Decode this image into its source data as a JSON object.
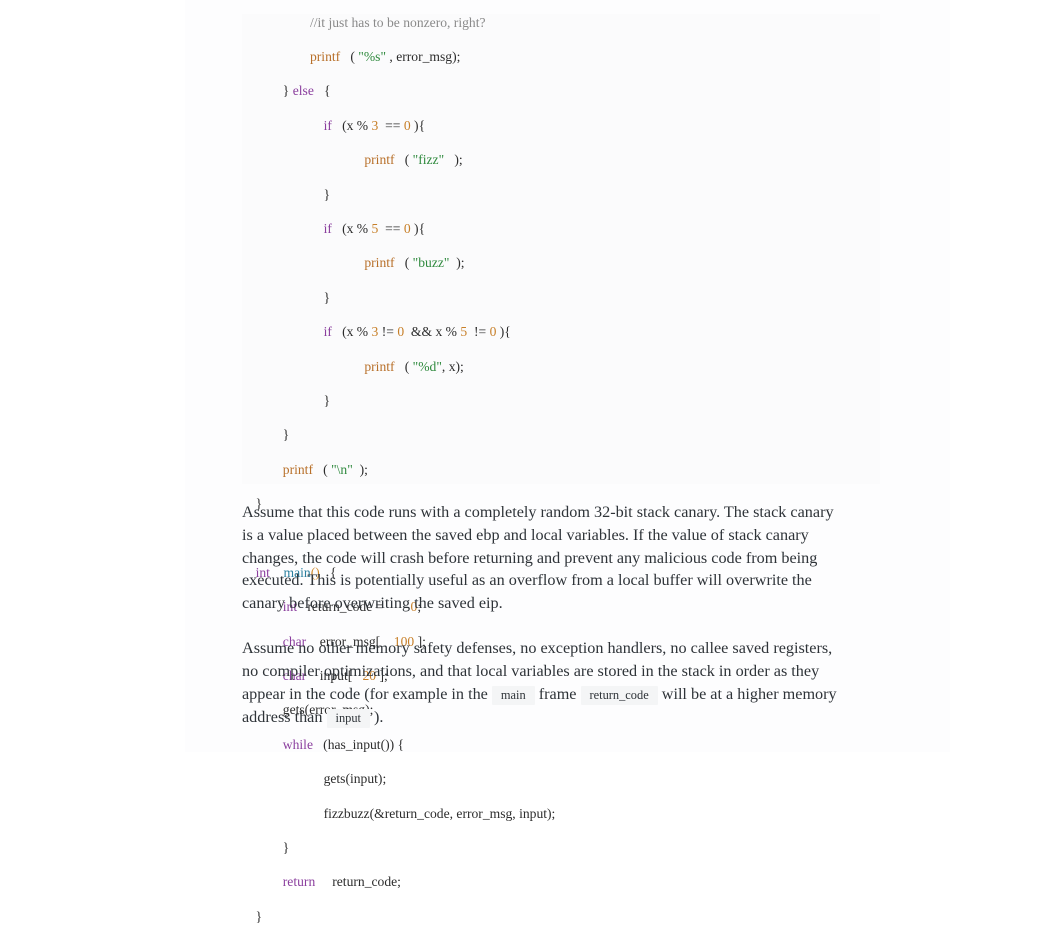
{
  "document": {
    "code_block": {
      "language": "c",
      "lines": [
        {
          "indent": 5,
          "tokens": [
            {
              "t": "cmt",
              "s": "//it just has to be nonzero, right?"
            }
          ]
        },
        {
          "indent": 5,
          "tokens": [
            {
              "t": "fn",
              "s": "printf"
            },
            {
              "t": "pl",
              "s": "   ( "
            },
            {
              "t": "str",
              "s": "\"%s\""
            },
            {
              "t": "pl",
              "s": " , error_msg);"
            }
          ]
        },
        {
          "indent": 3,
          "tokens": [
            {
              "t": "pl",
              "s": "} "
            },
            {
              "t": "kw",
              "s": "else"
            },
            {
              "t": "pl",
              "s": "   {"
            }
          ]
        },
        {
          "indent": 6,
          "tokens": [
            {
              "t": "kw",
              "s": "if"
            },
            {
              "t": "pl",
              "s": "   (x % "
            },
            {
              "t": "num",
              "s": "3"
            },
            {
              "t": "pl",
              "s": "  == "
            },
            {
              "t": "num",
              "s": "0"
            },
            {
              "t": "pl",
              "s": " ){"
            }
          ]
        },
        {
          "indent": 9,
          "tokens": [
            {
              "t": "fn",
              "s": "printf"
            },
            {
              "t": "pl",
              "s": "   ( "
            },
            {
              "t": "str",
              "s": "\"fizz\""
            },
            {
              "t": "pl",
              "s": "   );"
            }
          ]
        },
        {
          "indent": 6,
          "tokens": [
            {
              "t": "pl",
              "s": "}"
            }
          ]
        },
        {
          "indent": 6,
          "tokens": [
            {
              "t": "kw",
              "s": "if"
            },
            {
              "t": "pl",
              "s": "   (x % "
            },
            {
              "t": "num",
              "s": "5"
            },
            {
              "t": "pl",
              "s": "  == "
            },
            {
              "t": "num",
              "s": "0"
            },
            {
              "t": "pl",
              "s": " ){"
            }
          ]
        },
        {
          "indent": 9,
          "tokens": [
            {
              "t": "fn",
              "s": "printf"
            },
            {
              "t": "pl",
              "s": "   ( "
            },
            {
              "t": "str",
              "s": "\"buzz\""
            },
            {
              "t": "pl",
              "s": "  );"
            }
          ]
        },
        {
          "indent": 6,
          "tokens": [
            {
              "t": "pl",
              "s": "}"
            }
          ]
        },
        {
          "indent": 6,
          "tokens": [
            {
              "t": "kw",
              "s": "if"
            },
            {
              "t": "pl",
              "s": "   (x % "
            },
            {
              "t": "num",
              "s": "3"
            },
            {
              "t": "pl",
              "s": " != "
            },
            {
              "t": "num",
              "s": "0"
            },
            {
              "t": "pl",
              "s": "  && x % "
            },
            {
              "t": "num",
              "s": "5"
            },
            {
              "t": "pl",
              "s": "  != "
            },
            {
              "t": "num",
              "s": "0"
            },
            {
              "t": "pl",
              "s": " ){"
            }
          ]
        },
        {
          "indent": 9,
          "tokens": [
            {
              "t": "fn",
              "s": "printf"
            },
            {
              "t": "pl",
              "s": "   ( "
            },
            {
              "t": "str",
              "s": "\"%d\""
            },
            {
              "t": "pl",
              "s": ", x);"
            }
          ]
        },
        {
          "indent": 6,
          "tokens": [
            {
              "t": "pl",
              "s": "}"
            }
          ]
        },
        {
          "indent": 3,
          "tokens": [
            {
              "t": "pl",
              "s": "}"
            }
          ]
        },
        {
          "indent": 3,
          "tokens": [
            {
              "t": "fn",
              "s": "printf"
            },
            {
              "t": "pl",
              "s": "   ( "
            },
            {
              "t": "str",
              "s": "\"\\n\""
            },
            {
              "t": "pl",
              "s": "  );"
            }
          ]
        },
        {
          "indent": 1,
          "tokens": [
            {
              "t": "pl",
              "s": "}"
            }
          ]
        },
        {
          "indent": 0,
          "tokens": [
            {
              "t": "pl",
              "s": ""
            }
          ]
        },
        {
          "indent": 1,
          "tokens": [
            {
              "t": "kw",
              "s": "int"
            },
            {
              "t": "pl",
              "s": "    "
            },
            {
              "t": "fname",
              "s": "main"
            },
            {
              "t": "paren",
              "s": "()"
            },
            {
              "t": "pl",
              "s": "   {"
            }
          ]
        },
        {
          "indent": 3,
          "tokens": [
            {
              "t": "kw",
              "s": "int"
            },
            {
              "t": "pl",
              "s": "   return_code =        "
            },
            {
              "t": "num",
              "s": "0"
            },
            {
              "t": "pl",
              "s": ";"
            }
          ]
        },
        {
          "indent": 3,
          "tokens": [
            {
              "t": "kw",
              "s": "char"
            },
            {
              "t": "pl",
              "s": "    error_msg[    "
            },
            {
              "t": "num",
              "s": "100"
            },
            {
              "t": "pl",
              "s": " ];"
            }
          ]
        },
        {
          "indent": 3,
          "tokens": [
            {
              "t": "kw",
              "s": "char"
            },
            {
              "t": "pl",
              "s": "    input[   "
            },
            {
              "t": "num",
              "s": "20"
            },
            {
              "t": "pl",
              "s": " ];"
            }
          ]
        },
        {
          "indent": 3,
          "tokens": [
            {
              "t": "pl",
              "s": "gets(error_msg);"
            }
          ]
        },
        {
          "indent": 3,
          "tokens": [
            {
              "t": "kw",
              "s": "while"
            },
            {
              "t": "pl",
              "s": "   (has_input()) {"
            }
          ]
        },
        {
          "indent": 6,
          "tokens": [
            {
              "t": "pl",
              "s": "gets(input);"
            }
          ]
        },
        {
          "indent": 6,
          "tokens": [
            {
              "t": "pl",
              "s": "fizzbuzz(&return_code, error_msg, input);"
            }
          ]
        },
        {
          "indent": 3,
          "tokens": [
            {
              "t": "pl",
              "s": "}"
            }
          ]
        },
        {
          "indent": 3,
          "tokens": [
            {
              "t": "kw",
              "s": "return"
            },
            {
              "t": "pl",
              "s": "     return_code;"
            }
          ]
        },
        {
          "indent": 1,
          "tokens": [
            {
              "t": "pl",
              "s": "}"
            }
          ]
        }
      ]
    },
    "paragraphs": [
      {
        "id": "para-1",
        "runs": [
          {
            "type": "text",
            "s": "Assume that this code runs with a completely random 32-bit stack canary. The stack canary is a value placed between the saved ebp and local variables. If the value of stack canary changes, the code will crash before returning and prevent any malicious code from being executed. This is potentially useful as an overflow from a local buffer will overwrite the canary before overwriting the saved eip."
          }
        ]
      },
      {
        "id": "para-2",
        "runs": [
          {
            "type": "text",
            "s": "Assume no other memory safety defenses, no exception handlers, no callee saved registers, no compiler optimizations, and that local variables are stored in the stack in order as they appear in the code (for example in the "
          },
          {
            "type": "code",
            "s": "main"
          },
          {
            "type": "text",
            "s": " frame "
          },
          {
            "type": "code",
            "s": "return_code"
          },
          {
            "type": "text",
            "s": " will be at a higher memory address than "
          },
          {
            "type": "code",
            "s": "input"
          },
          {
            "type": "text",
            "s": " )."
          }
        ]
      }
    ]
  },
  "theme": {
    "page_background": "#ffffff",
    "sheet_background": "#fdfdfe",
    "code_background": "#fbfbfc",
    "inline_code_background": "#f4f5f6",
    "text_color": "#2e3338",
    "keyword_color": "#8b3f9e",
    "function_color": "#b8702a",
    "function_name_color": "#2a7f9e",
    "string_color": "#2f8a3e",
    "number_color": "#c77f28",
    "paren_color": "#d08a2c",
    "comment_color": "#8a8a8a"
  }
}
